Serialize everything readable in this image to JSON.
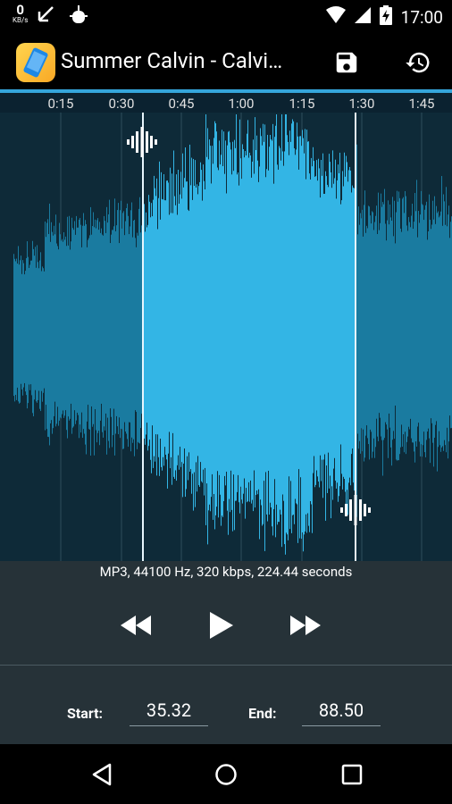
{
  "status_bar": {
    "speed_value": "0",
    "speed_unit": "KB/s",
    "time": "17:00"
  },
  "toolbar": {
    "title": "Summer Calvin - Calvi…",
    "save_icon": "save-icon",
    "history_icon": "history-icon"
  },
  "timeline": {
    "ticks": [
      "0:15",
      "0:30",
      "0:45",
      "1:00",
      "1:15",
      "1:30",
      "1:45"
    ]
  },
  "file_info": "MP3, 44100 Hz, 320 kbps, 224.44 seconds",
  "playback": {
    "rewind_icon": "rewind-icon",
    "play_icon": "play-icon",
    "forward_icon": "fast-forward-icon"
  },
  "selection": {
    "start_label": "Start:",
    "start_value": "35.32",
    "end_label": "End:",
    "end_value": "88.50"
  },
  "colors": {
    "accent": "#35a6dc",
    "waveform_selected": "#33b5e5",
    "waveform_unselected": "#1a7ba0",
    "background": "#263238"
  }
}
